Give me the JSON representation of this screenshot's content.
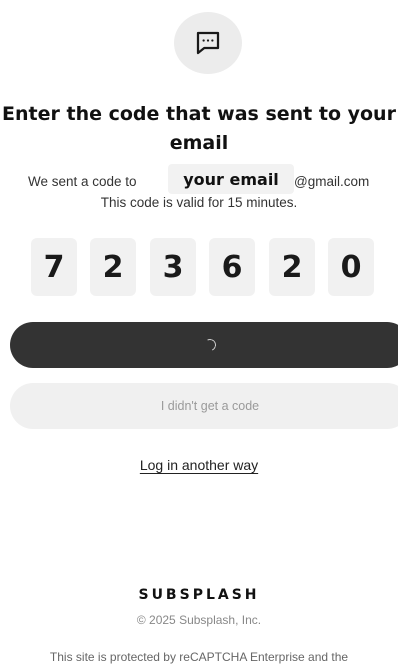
{
  "header": {
    "icon": "chat-bubble-icon",
    "title_line1": "Enter the code that was sent to your",
    "title_line2": "email"
  },
  "message": {
    "sent_prefix": "We sent a code to",
    "email_redacted": "your email",
    "email_domain": "@gmail.com",
    "validity": "This code is valid for 15 minutes."
  },
  "code": {
    "digits": [
      "7",
      "2",
      "3",
      "6",
      "2",
      "0"
    ]
  },
  "buttons": {
    "secondary_label": "I didn't get a code",
    "alt_login_label": "Log in another way"
  },
  "footer": {
    "brand": "SUBSPLASH",
    "copyright": "© 2025 Subsplash, Inc.",
    "legal": "This site is protected by reCAPTCHA Enterprise and the"
  },
  "colors": {
    "primary_button": "#333333",
    "secondary_button": "#f0f0f0",
    "digit_box": "#f1f1f1"
  }
}
